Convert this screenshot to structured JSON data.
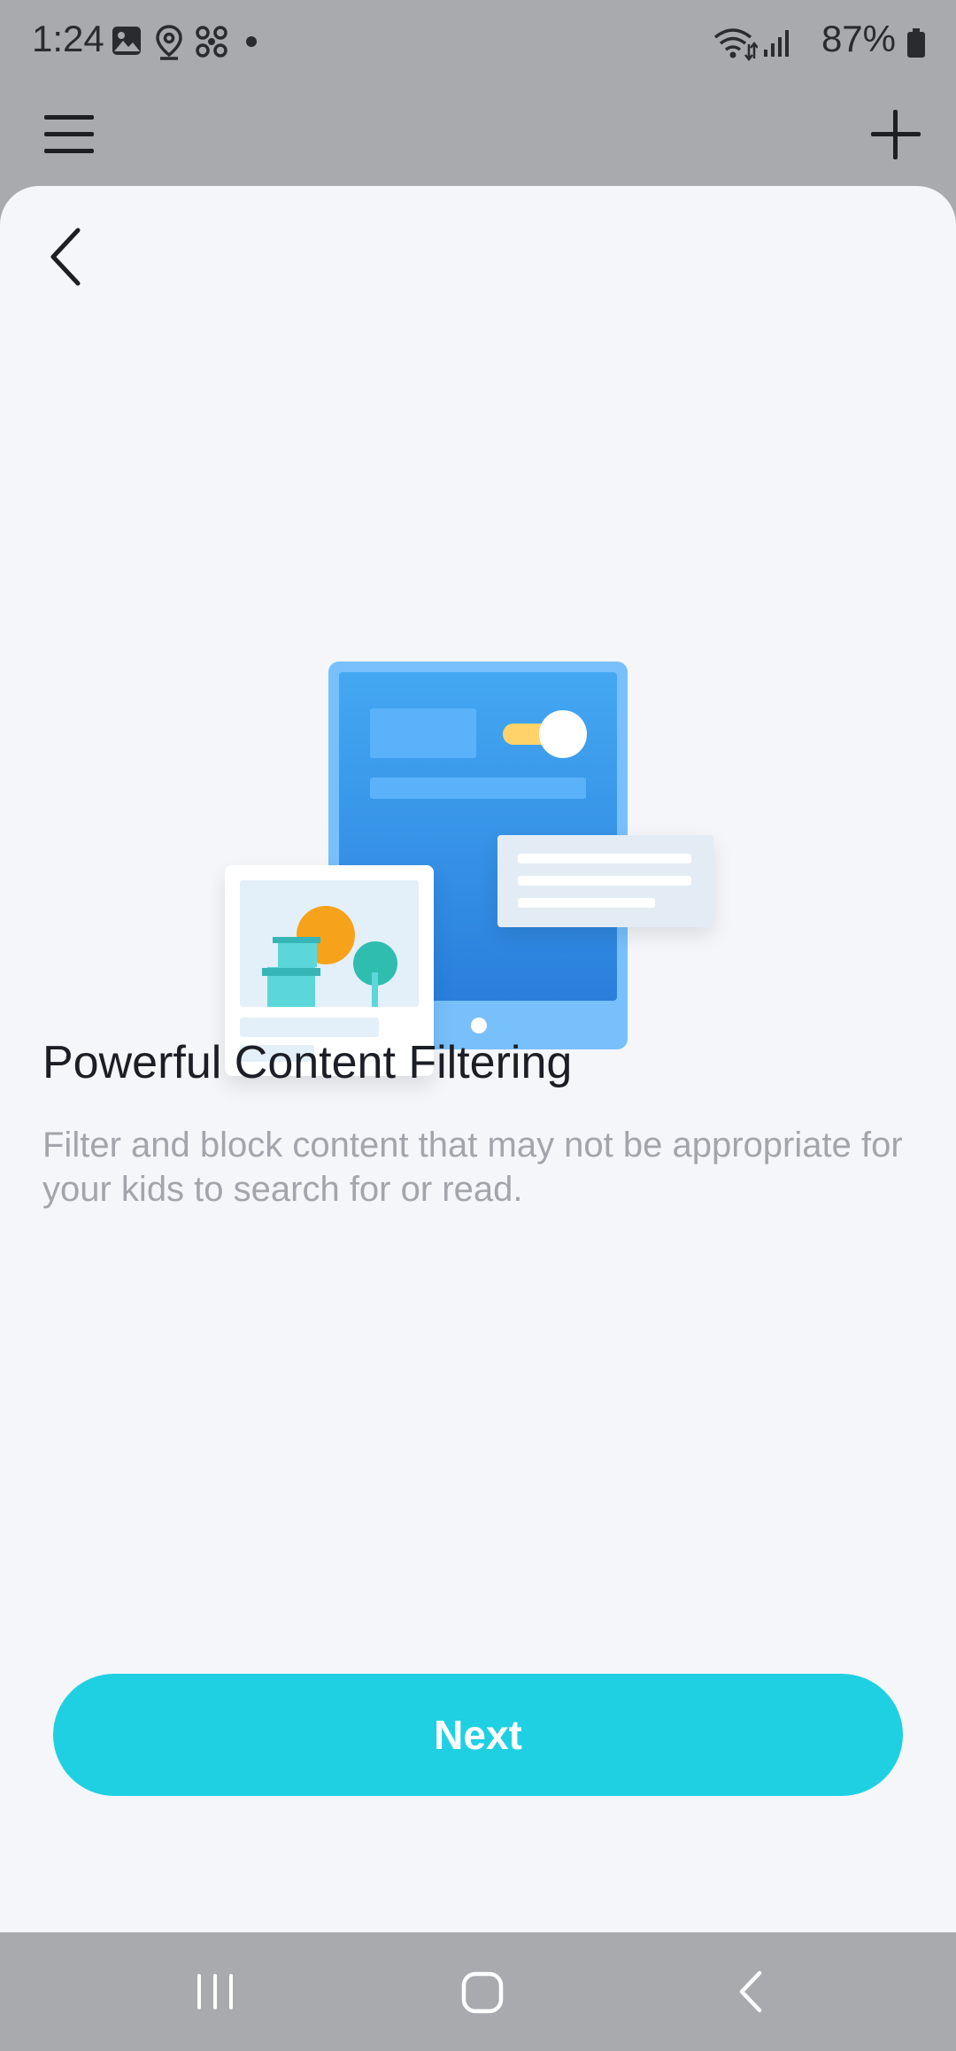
{
  "status_bar": {
    "time": "1:24",
    "battery": "87%",
    "icons": [
      "gallery-icon",
      "location-icon",
      "fan-icon",
      "dot-icon",
      "wifi-icon",
      "signal-icon",
      "battery-icon"
    ]
  },
  "app_bar": {
    "menu_icon": "hamburger-menu-icon",
    "add_icon": "plus-icon"
  },
  "sheet": {
    "back_icon": "chevron-left-icon",
    "title": "Powerful Content Filtering",
    "description": "Filter and block content that may not be appropriate for your kids to search for or read.",
    "next_label": "Next",
    "accent_color": "#1fd0e3"
  },
  "nav_bar": {
    "recent_icon": "recent-apps-icon",
    "home_icon": "home-icon",
    "back_icon": "system-back-icon"
  }
}
